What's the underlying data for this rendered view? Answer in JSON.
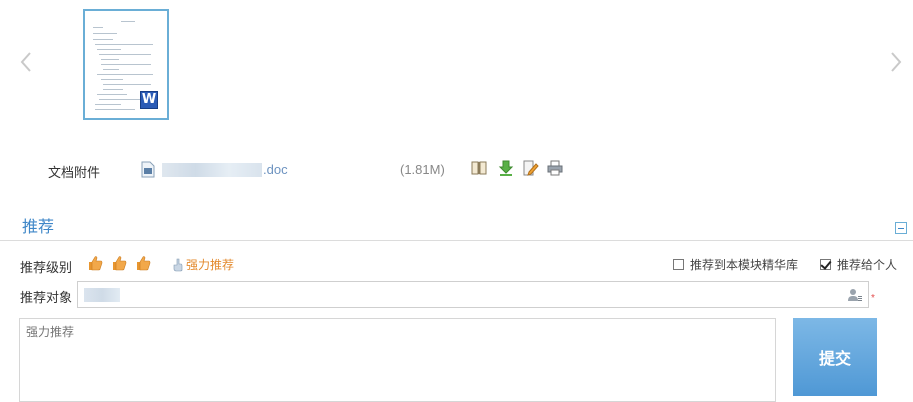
{
  "carousel": {
    "prev_icon": "chevron-left-icon",
    "next_icon": "chevron-right-icon",
    "thumbnail_badge": "W"
  },
  "attachment": {
    "label": "文档附件",
    "filename_ext": ".doc",
    "size": "(1.81M)",
    "tools": [
      "book-icon",
      "download-icon",
      "edit-icon",
      "print-icon"
    ]
  },
  "recommend": {
    "section_title": "推荐",
    "level_label": "推荐级别",
    "level_icons": [
      "thumbs-up-icon",
      "thumbs-up-icon",
      "thumbs-up-icon"
    ],
    "strong_recommend": "强力推荐",
    "checkbox_module": {
      "label": "推荐到本模块精华库",
      "checked": false
    },
    "checkbox_personal": {
      "label": "推荐给个人",
      "checked": true
    },
    "target_label": "推荐对象",
    "required_mark": "*",
    "comment_placeholder": "强力推荐",
    "submit_label": "提交"
  },
  "colors": {
    "accent": "#3f87c8",
    "thumb_orange": "#e8962f",
    "strong_text": "#e38a2e",
    "submit_bg": "#5fa6dd"
  }
}
